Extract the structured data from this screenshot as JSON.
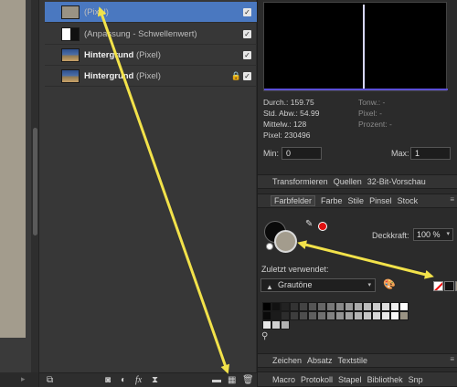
{
  "layers": [
    {
      "name": "",
      "sub": "(Pixel)",
      "thumb": "gray",
      "selected": true,
      "locked": false
    },
    {
      "name": "",
      "sub": "(Anpassung - Schwellenwert)",
      "thumb": "threshold",
      "selected": false,
      "locked": false
    },
    {
      "name": "Hintergrund",
      "sub": " (Pixel)",
      "thumb": "photo",
      "selected": false,
      "locked": false
    },
    {
      "name": "Hintergrund",
      "sub": " (Pixel)",
      "thumb": "photo",
      "selected": false,
      "locked": true
    }
  ],
  "histogram": {
    "stats_left": [
      "Durch.: 159.75",
      "Std. Abw.: 54.99",
      "Mittelw.: 128",
      "Pixel: 230496"
    ],
    "stats_right": [
      "Tonw.: -",
      "Pixel: -",
      "Prozent: -"
    ],
    "min_label": "Min:",
    "min_value": "0",
    "max_label": "Max:",
    "max_value": "1",
    "spike_value": 128
  },
  "tabs_top": [
    "Transformieren",
    "Quellen",
    "32-Bit-Vorschau"
  ],
  "tabs_swatch": [
    "Farbfelder",
    "Farbe",
    "Stile",
    "Pinsel",
    "Stock"
  ],
  "tabs_text": [
    "Zeichen",
    "Absatz",
    "Textstile"
  ],
  "tabs_bottom": [
    "Macro",
    "Protokoll",
    "Stapel",
    "Bibliothek",
    "Snp"
  ],
  "opacity_label": "Deckkraft:",
  "opacity_value": "100 %",
  "recent_label": "Zuletzt verwendet:",
  "palette_name": "Grautöne",
  "colors": {
    "fill": "#0a0a0a",
    "stroke": "#a39c8d",
    "accent": "#4a78c0",
    "annotation": "#f2e24a",
    "recent": [
      "#111111",
      "#9a9384",
      "#ffffff"
    ]
  },
  "grays": [
    "#000000",
    "#111111",
    "#222222",
    "#333333",
    "#444444",
    "#555555",
    "#666666",
    "#777777",
    "#888888",
    "#999999",
    "#aaaaaa",
    "#bbbbbb",
    "#cccccc",
    "#dddddd",
    "#eeeeee",
    "#ffffff",
    "#0a0a0a",
    "#1b1b1b",
    "#2c2c2c",
    "#3d3d3d",
    "#4e4e4e",
    "#5f5f5f",
    "#707070",
    "#818181",
    "#929292",
    "#a3a3a3",
    "#b4b4b4",
    "#c5c5c5",
    "#d6d6d6",
    "#e7e7e7",
    "#f8f8f8",
    "#9a9384",
    "#e8e8e8",
    "#d0d0d0",
    "#b0b0b0"
  ],
  "icons": [
    "layer-settings-icon",
    "mask-icon",
    "adjustment-icon",
    "fx-icon",
    "live-filter-icon",
    "folder-icon",
    "add-layer-icon",
    "trash-icon",
    "pipette-icon",
    "palette-icon",
    "zoom-icon",
    "lock-icon",
    "checkbox-icon"
  ]
}
